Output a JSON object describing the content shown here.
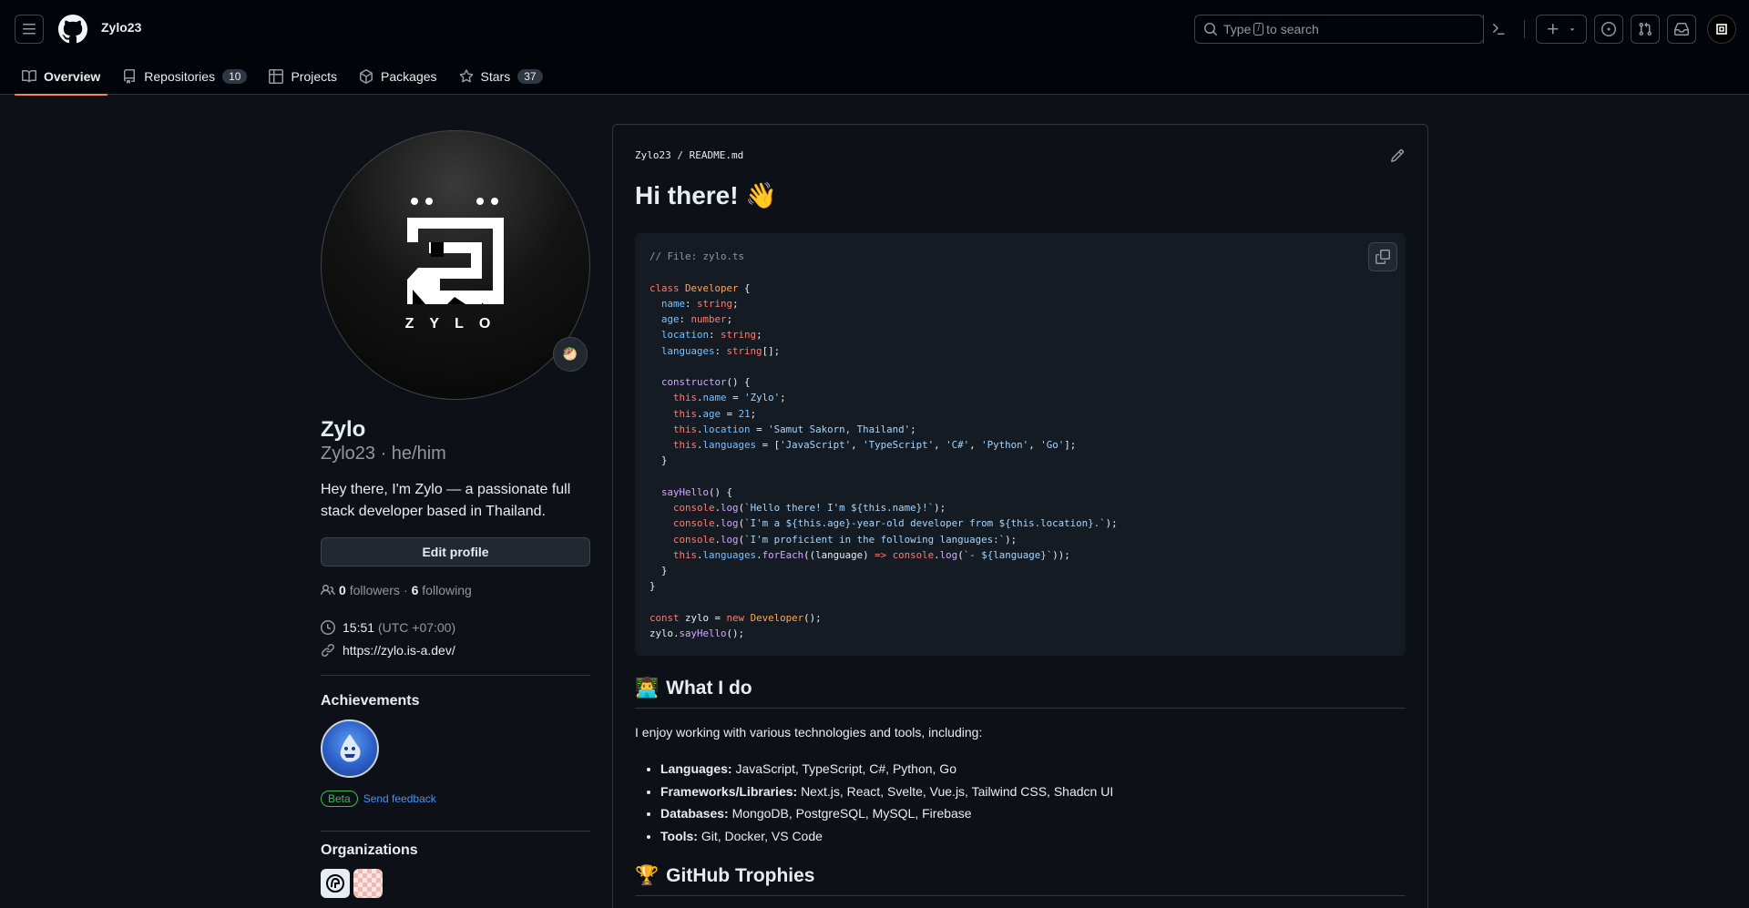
{
  "header": {
    "context_user": "Zylo23",
    "search": {
      "prefix": "Type",
      "key": "/",
      "suffix": "to search"
    }
  },
  "tabs": [
    {
      "label": "Overview",
      "count": null
    },
    {
      "label": "Repositories",
      "count": "10"
    },
    {
      "label": "Projects",
      "count": null
    },
    {
      "label": "Packages",
      "count": null
    },
    {
      "label": "Stars",
      "count": "37"
    }
  ],
  "profile": {
    "logo_text": "ZYLO",
    "status_emoji": "🥙",
    "name": "Zylo",
    "username_line": "Zylo23 · he/him",
    "bio": "Hey there, I'm Zylo — a passionate full stack developer based in Thailand.",
    "edit_label": "Edit profile",
    "followers_count": "0",
    "followers_label": "followers",
    "following_count": "6",
    "following_label": "following",
    "time": "15:51",
    "timezone": "(UTC +07:00)",
    "website": "https://zylo.is-a.dev/",
    "achievements_title": "Achievements",
    "beta_label": "Beta",
    "feedback_label": "Send feedback",
    "organizations_title": "Organizations"
  },
  "readme": {
    "owner": "Zylo23",
    "file": "README.md",
    "greeting": "Hi there!",
    "greeting_emoji": "👋",
    "code_lines": [
      "// File: zylo.ts",
      "",
      "class Developer {",
      "  name: string;",
      "  age: number;",
      "  location: string;",
      "  languages: string[];",
      "",
      "  constructor() {",
      "    this.name = 'Zylo';",
      "    this.age = 21;",
      "    this.location = 'Samut Sakorn, Thailand';",
      "    this.languages = ['JavaScript', 'TypeScript', 'C#', 'Python', 'Go'];",
      "  }",
      "",
      "  sayHello() {",
      "    console.log(`Hello there! I'm ${this.name}!`);",
      "    console.log(`I'm a ${this.age}-year-old developer from ${this.location}.`);",
      "    console.log(`I'm proficient in the following languages:`);",
      "    this.languages.forEach((language) => console.log(`- ${language}`));",
      "  }",
      "}",
      "",
      "const zylo = new Developer();",
      "zylo.sayHello();"
    ],
    "section1_emoji": "👨‍💻",
    "section1_title": "What I do",
    "intro": "I enjoy working with various technologies and tools, including:",
    "list": [
      {
        "label": "Languages:",
        "value": "JavaScript, TypeScript, C#, Python, Go"
      },
      {
        "label": "Frameworks/Libraries:",
        "value": "Next.js, React, Svelte, Vue.js, Tailwind CSS, Shadcn UI"
      },
      {
        "label": "Databases:",
        "value": "MongoDB, PostgreSQL, MySQL, Firebase"
      },
      {
        "label": "Tools:",
        "value": "Git, Docker, VS Code"
      }
    ],
    "section2_emoji": "🏆",
    "section2_title": "GitHub Trophies"
  },
  "colors": {
    "bg": "#0d1117",
    "header_bg": "#010409",
    "border": "#30363d",
    "accent_tab": "#f78166",
    "link": "#4493f8",
    "beta": "#3fb950"
  }
}
